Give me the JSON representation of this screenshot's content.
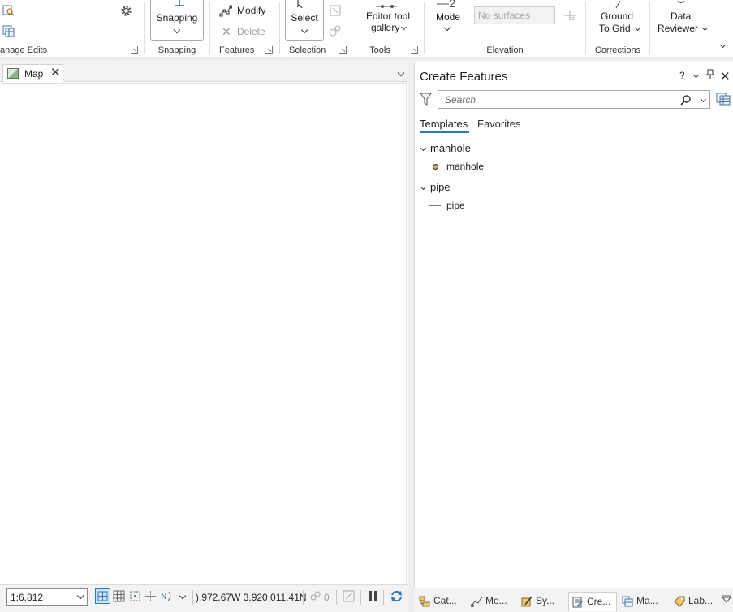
{
  "ribbon": {
    "manage_edits_label": "anage Edits",
    "snapping_button": "Snapping",
    "snapping_group": "Snapping",
    "modify_button": "Modify",
    "delete_button": "Delete",
    "features_group": "Features",
    "select_button": "Select",
    "selection_group": "Selection",
    "editor_tool_gallery_line1": "Editor tool",
    "editor_tool_gallery_line2": "gallery",
    "tools_group": "Tools",
    "mode_button": "Mode",
    "surface_placeholder": "No surfaces",
    "elevation_group": "Elevation",
    "ground_to_grid_line1": "Ground",
    "ground_to_grid_line2": "To Grid",
    "corrections_group": "Corrections",
    "data_reviewer_line1": "Data",
    "data_reviewer_line2": "Reviewer"
  },
  "map": {
    "tab_label": "Map",
    "scale": "1:6,812",
    "coordinates": "),972.67W 3,920,011.41N",
    "selected_count": "0"
  },
  "create_features": {
    "title": "Create Features",
    "help_icon_label": "?",
    "search_placeholder": "Search",
    "tabs": [
      "Templates",
      "Favorites"
    ],
    "layers": [
      {
        "name": "manhole",
        "templates": [
          "manhole"
        ]
      },
      {
        "name": "pipe",
        "templates": [
          "pipe"
        ]
      }
    ]
  },
  "dock_tabs": [
    "Cat...",
    "Mo...",
    "Sy...",
    "Cre...",
    "Ma...",
    "Lab..."
  ],
  "colors": {
    "accent": "#2b79c2",
    "point_symbol_fill": "#c9a66b"
  }
}
